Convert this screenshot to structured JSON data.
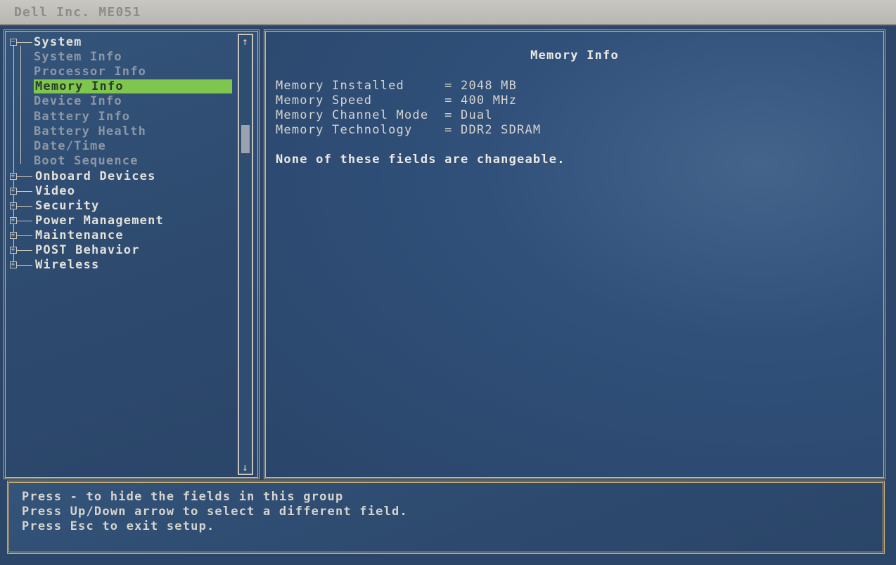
{
  "window": {
    "title": "Dell Inc. ME051"
  },
  "tree": {
    "root": {
      "label": "System",
      "expanded": true
    },
    "children": [
      {
        "label": "System Info"
      },
      {
        "label": "Processor Info"
      },
      {
        "label": "Memory Info",
        "selected": true
      },
      {
        "label": "Device Info"
      },
      {
        "label": "Battery Info"
      },
      {
        "label": "Battery Health"
      },
      {
        "label": "Date/Time"
      },
      {
        "label": "Boot Sequence"
      }
    ],
    "groups": [
      {
        "label": "Onboard Devices"
      },
      {
        "label": "Video"
      },
      {
        "label": "Security"
      },
      {
        "label": "Power Management"
      },
      {
        "label": "Maintenance"
      },
      {
        "label": "POST Behavior"
      },
      {
        "label": "Wireless"
      }
    ]
  },
  "info_panel": {
    "title": "Memory Info",
    "fields": [
      {
        "label": "Memory Installed     ",
        "value": "= 2048 MB"
      },
      {
        "label": "Memory Speed         ",
        "value": "= 400 MHz"
      },
      {
        "label": "Memory Channel Mode  ",
        "value": "= Dual"
      },
      {
        "label": "Memory Technology    ",
        "value": "= DDR2 SDRAM"
      }
    ],
    "note": "None of these fields are changeable."
  },
  "help": {
    "lines": [
      "Press - to hide the fields in this group",
      "Press Up/Down arrow to select a different field.",
      "Press Esc to exit setup."
    ]
  },
  "colors": {
    "background": "#2b4668",
    "border": "#d2b272",
    "highlight": "#7ec64e"
  },
  "icons": {
    "collapse": "minus-box-icon",
    "expand": "plus-box-icon",
    "scroll_up": "arrow-up-icon",
    "scroll_down": "arrow-down-icon"
  }
}
